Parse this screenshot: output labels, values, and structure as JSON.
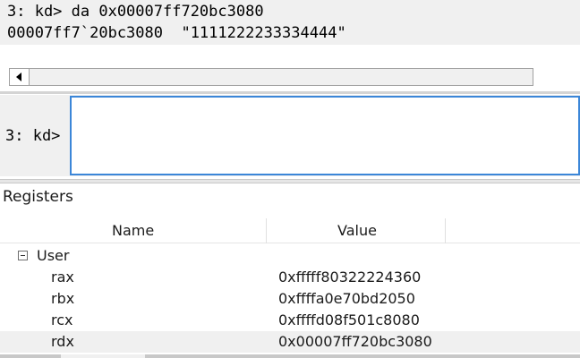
{
  "output": {
    "lines": [
      "3: kd> da 0x00007ff720bc3080",
      "00007ff7`20bc3080  \"1111222233334444\""
    ]
  },
  "prompt": {
    "label": "3: kd>",
    "input_value": ""
  },
  "registers": {
    "title": "Registers",
    "columns": [
      "Name",
      "Value"
    ],
    "group": "User",
    "rows": [
      {
        "name": "rax",
        "value": "0xfffff80322224360"
      },
      {
        "name": "rbx",
        "value": "0xffffa0e70bd2050"
      },
      {
        "name": "rcx",
        "value": "0xffffd08f501c8080"
      },
      {
        "name": "rdx",
        "value": "0x00007ff720bc3080"
      }
    ]
  },
  "colors": {
    "input_border": "#3b86d8",
    "panel_bg": "#f0f0f0"
  }
}
